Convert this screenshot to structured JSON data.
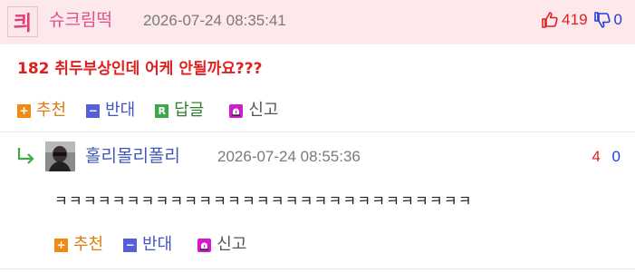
{
  "comment": {
    "author": "슈크림떡",
    "avatar_glyph": "킈",
    "date": "2026-07-24 08:35:41",
    "up_count": "419",
    "down_count": "0",
    "title": "182 취두부상인데 어케 안될까요???",
    "actions": {
      "recommend": "추천",
      "oppose": "반대",
      "reply": "답글",
      "report": "신고"
    },
    "icons": {
      "thumb_up": "thumb-up-icon",
      "thumb_down": "thumb-down-icon",
      "reply_box": "R"
    }
  },
  "reply": {
    "author": "홀리몰리폴리",
    "date": "2026-07-24 08:55:36",
    "up_count": "4",
    "down_count": "0",
    "text": "ㅋㅋㅋㅋㅋㅋㅋㅋㅋㅋㅋㅋㅋㅋㅋㅋㅋㅋㅋㅋㅋㅋㅋㅋㅋㅋㅋㅋㅋ",
    "actions": {
      "recommend": "추천",
      "oppose": "반대",
      "report": "신고"
    }
  },
  "colors": {
    "header_bg": "#fde8ec",
    "author_pink": "#e2508c",
    "author_blue": "#4257b6",
    "up_red": "#e01f1f",
    "down_blue": "#1f3fd6",
    "recommend_orange": "#f08a12",
    "oppose_blue": "#5560d8",
    "reply_green": "#3da84a",
    "report_magenta": "#d01ad0"
  }
}
